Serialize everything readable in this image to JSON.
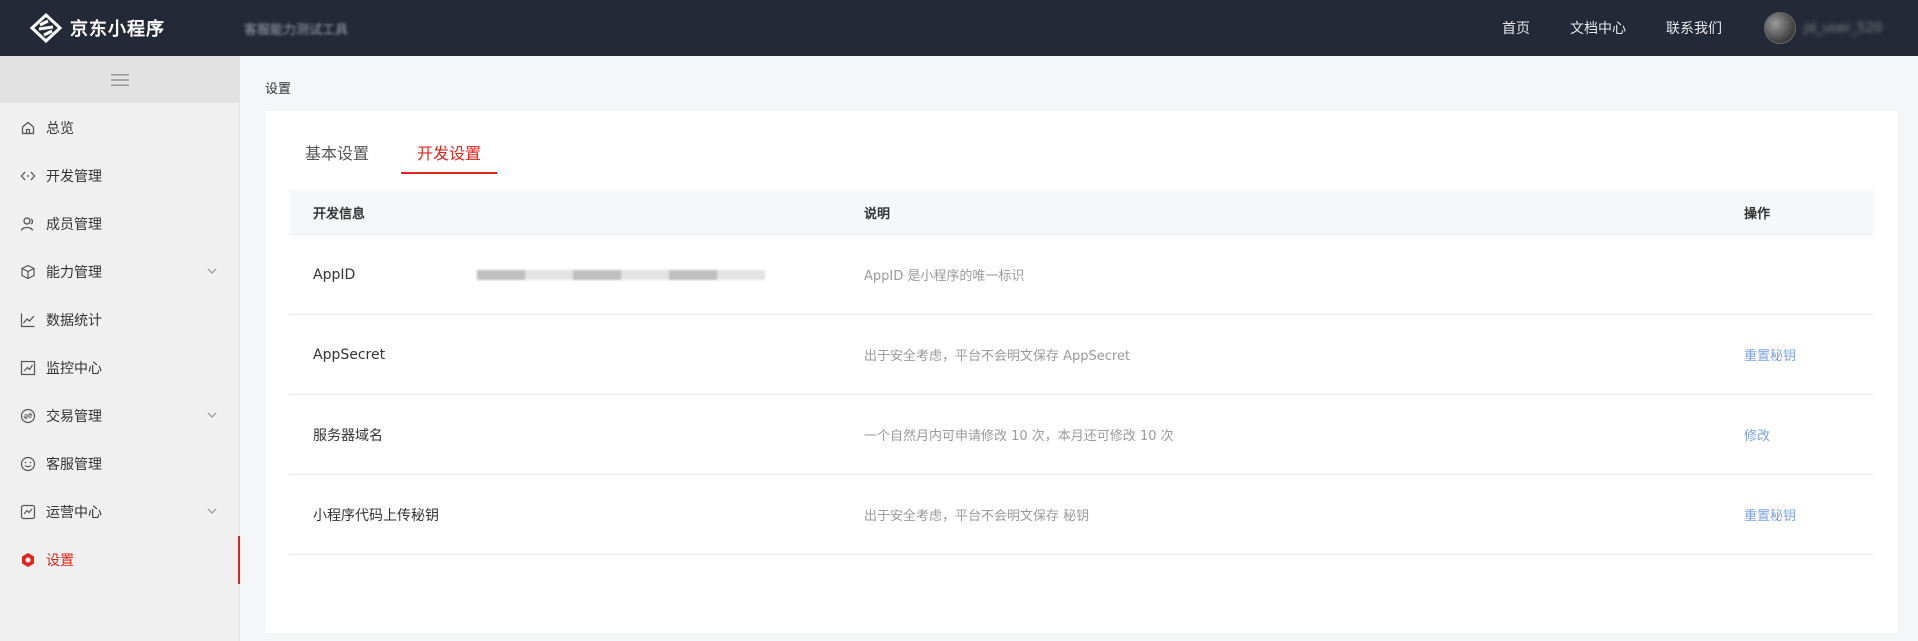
{
  "header": {
    "logo_text": "京东小程序",
    "app_name": "客服能力测试工具",
    "nav": [
      "首页",
      "文档中心",
      "联系我们"
    ],
    "username": "jd_user_520"
  },
  "sidebar": {
    "items": [
      {
        "label": "总览",
        "icon": "home-icon",
        "expandable": false,
        "active": false
      },
      {
        "label": "开发管理",
        "icon": "code-icon",
        "expandable": false,
        "active": false
      },
      {
        "label": "成员管理",
        "icon": "user-icon",
        "expandable": false,
        "active": false
      },
      {
        "label": "能力管理",
        "icon": "cube-icon",
        "expandable": true,
        "active": false
      },
      {
        "label": "数据统计",
        "icon": "line-chart-icon",
        "expandable": false,
        "active": false
      },
      {
        "label": "监控中心",
        "icon": "monitor-icon",
        "expandable": false,
        "active": false
      },
      {
        "label": "交易管理",
        "icon": "trade-icon",
        "expandable": true,
        "active": false
      },
      {
        "label": "客服管理",
        "icon": "chat-icon",
        "expandable": false,
        "active": false
      },
      {
        "label": "运营中心",
        "icon": "operation-icon",
        "expandable": true,
        "active": false
      },
      {
        "label": "设置",
        "icon": "hexagon-settings-icon",
        "expandable": false,
        "active": true
      }
    ]
  },
  "main": {
    "page_title": "设置",
    "tabs": [
      {
        "label": "基本设置",
        "active": false
      },
      {
        "label": "开发设置",
        "active": true
      }
    ],
    "table": {
      "headers": [
        "开发信息",
        "说明",
        "操作"
      ],
      "rows": [
        {
          "key": "AppID",
          "value_masked": true,
          "desc": "AppID 是小程序的唯一标识",
          "action": ""
        },
        {
          "key": "AppSecret",
          "value_masked": false,
          "desc": "出于安全考虑，平台不会明文保存 AppSecret",
          "action": "重置秘钥"
        },
        {
          "key": "服务器域名",
          "value_masked": false,
          "desc": "一个自然月内可申请修改 10 次，本月还可修改 10 次",
          "action": "修改"
        },
        {
          "key": "小程序代码上传秘钥",
          "value_masked": false,
          "desc": "出于安全考虑，平台不会明文保存 秘钥",
          "action": "重置秘钥"
        }
      ]
    }
  },
  "colors": {
    "topbar_bg": "#232936",
    "accent_red": "#e1251b",
    "link_blue": "#7aa3e6",
    "sidebar_bg": "#f0f0f0"
  }
}
